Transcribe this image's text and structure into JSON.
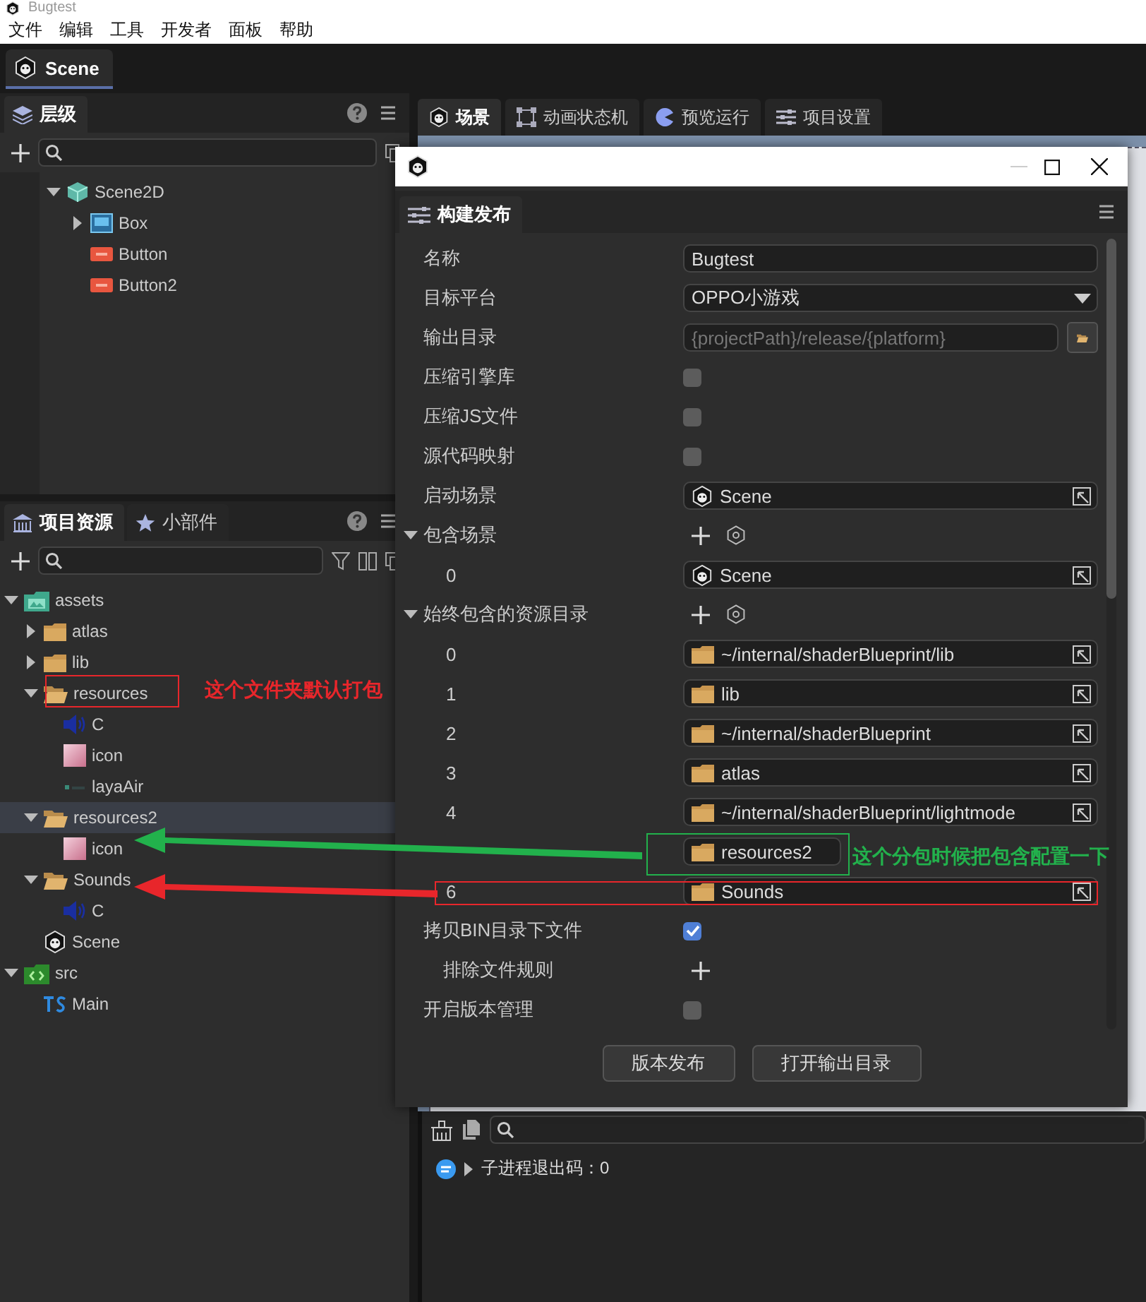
{
  "app": {
    "title": "Bugtest",
    "menu": [
      "文件",
      "编辑",
      "工具",
      "开发者",
      "面板",
      "帮助"
    ]
  },
  "document_tabs": [
    {
      "label": "Scene",
      "selected": true
    }
  ],
  "hierarchy": {
    "tabs": [
      {
        "label": "层级",
        "selected": true
      }
    ],
    "tree": [
      {
        "label": "Scene2D",
        "kind": "scene2d",
        "expanded": true,
        "selected": false,
        "children": [
          {
            "label": "Box",
            "kind": "box",
            "expanded": false,
            "selected": false
          },
          {
            "label": "Button",
            "kind": "button",
            "selected": false
          },
          {
            "label": "Button2",
            "kind": "button",
            "selected": false
          }
        ]
      }
    ]
  },
  "assets": {
    "tabs": [
      {
        "label": "项目资源",
        "selected": true
      },
      {
        "label": "小部件",
        "selected": false
      }
    ],
    "tree": [
      {
        "label": "assets",
        "kind": "root",
        "expanded": true,
        "selected": false,
        "children": [
          {
            "label": "atlas",
            "kind": "folder",
            "expanded": false,
            "selected": false
          },
          {
            "label": "lib",
            "kind": "folder",
            "expanded": false,
            "selected": false
          },
          {
            "label": "resources",
            "kind": "folder",
            "expanded": true,
            "selected": false,
            "children": [
              {
                "label": "C",
                "kind": "audio",
                "selected": false
              },
              {
                "label": "icon",
                "kind": "image",
                "selected": false
              },
              {
                "label": "layaAir",
                "kind": "file",
                "selected": false
              }
            ]
          },
          {
            "label": "resources2",
            "kind": "folder",
            "expanded": true,
            "selected": true,
            "children": [
              {
                "label": "icon",
                "kind": "image",
                "selected": false
              }
            ]
          },
          {
            "label": "Sounds",
            "kind": "folder",
            "expanded": true,
            "selected": false,
            "children": [
              {
                "label": "C",
                "kind": "audio",
                "selected": false
              }
            ]
          },
          {
            "label": "Scene",
            "kind": "scene",
            "selected": false
          }
        ]
      },
      {
        "label": "src",
        "kind": "code-root",
        "expanded": true,
        "selected": false,
        "children": [
          {
            "label": "Main",
            "kind": "ts",
            "selected": false
          }
        ]
      }
    ]
  },
  "editor_tabs": [
    {
      "label": "场景",
      "selected": true
    },
    {
      "label": "动画状态机",
      "selected": false
    },
    {
      "label": "预览运行",
      "selected": false
    },
    {
      "label": "项目设置",
      "selected": false
    }
  ],
  "build_dialog": {
    "tab": "构建发布",
    "rows": [
      {
        "kind": "text",
        "label": "名称",
        "value": "Bugtest"
      },
      {
        "kind": "select",
        "label": "目标平台",
        "value": "OPPO小游戏"
      },
      {
        "kind": "path",
        "label": "输出目录",
        "placeholder": "{projectPath}/release/{platform}"
      },
      {
        "kind": "checkbox",
        "label": "压缩引擎库",
        "checked": false
      },
      {
        "kind": "checkbox",
        "label": "压缩JS文件",
        "checked": false
      },
      {
        "kind": "checkbox",
        "label": "源代码映射",
        "checked": false
      },
      {
        "kind": "scene",
        "label": "启动场景",
        "value": "Scene"
      },
      {
        "kind": "group",
        "label": "包含场景",
        "expanded": true,
        "items": [
          {
            "kind": "scene",
            "index": "0",
            "value": "Scene"
          }
        ]
      },
      {
        "kind": "group",
        "label": "始终包含的资源目录",
        "expanded": true,
        "items": [
          {
            "kind": "folder",
            "index": "0",
            "value": "~/internal/shaderBlueprint/lib"
          },
          {
            "kind": "folder",
            "index": "1",
            "value": "lib"
          },
          {
            "kind": "folder",
            "index": "2",
            "value": "~/internal/shaderBlueprint"
          },
          {
            "kind": "folder",
            "index": "3",
            "value": "atlas"
          },
          {
            "kind": "folder",
            "index": "4",
            "value": "~/internal/shaderBlueprint/lightmode"
          },
          {
            "kind": "folder",
            "value": "resources2"
          },
          {
            "kind": "folder",
            "index": "6",
            "value": "Sounds"
          }
        ]
      },
      {
        "kind": "checkbox",
        "label": "拷贝BIN目录下文件",
        "checked": true
      },
      {
        "kind": "add",
        "label": "排除文件规则"
      },
      {
        "kind": "checkbox",
        "label": "开启版本管理",
        "checked": false
      }
    ],
    "buttons": [
      "版本发布",
      "打开输出目录"
    ]
  },
  "console": {
    "lines": [
      {
        "text": "子进程退出码：0",
        "expanded": false
      }
    ]
  },
  "annotations": [
    {
      "kind": "box",
      "color": "#e8262b"
    },
    {
      "kind": "note",
      "text": "这个文件夹默认打包",
      "color": "#e8262b"
    },
    {
      "kind": "arrow",
      "color": "#22b14c"
    },
    {
      "kind": "box",
      "color": "#22b14c"
    },
    {
      "kind": "note",
      "text": "这个分包时候把包含配置一下",
      "color": "#22b14c"
    },
    {
      "kind": "box",
      "color": "#e8262b"
    },
    {
      "kind": "arrow",
      "color": "#e8262b"
    }
  ]
}
